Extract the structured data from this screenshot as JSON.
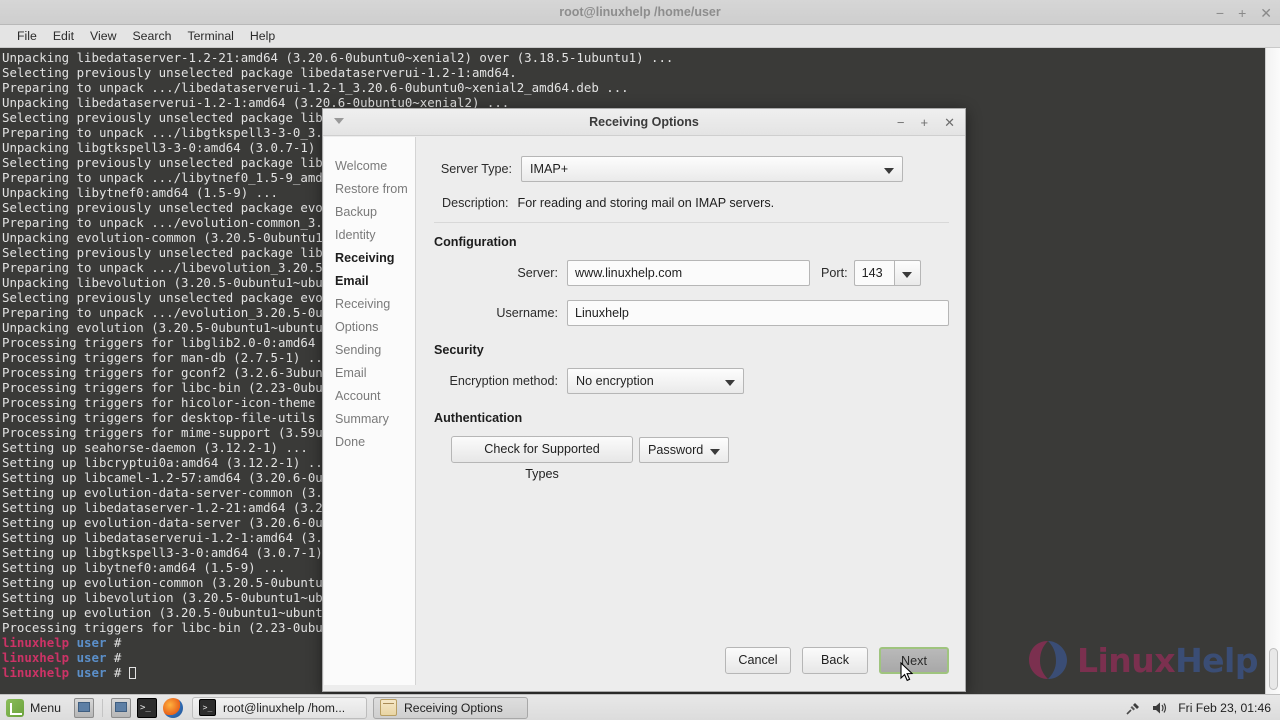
{
  "terminal": {
    "title": "root@linuxhelp /home/user",
    "menus": [
      "File",
      "Edit",
      "View",
      "Search",
      "Terminal",
      "Help"
    ],
    "window_buttons": {
      "minimize": "−",
      "maximize": "+",
      "close": "✕"
    },
    "lines": [
      "Unpacking libedataserver-1.2-21:amd64 (3.20.6-0ubuntu0~xenial2) over (3.18.5-1ubuntu1) ...",
      "Selecting previously unselected package libedataserverui-1.2-1:amd64.",
      "Preparing to unpack .../libedataserverui-1.2-1_3.20.6-0ubuntu0~xenial2_amd64.deb ...",
      "Unpacking libedataserverui-1.2-1:amd64 (3.20.6-0ubuntu0~xenial2) ...",
      "Selecting previously unselected package libgtkspell3-3-0:amd64.",
      "Preparing to unpack .../libgtkspell3-3-0_3.0.7-1_amd64.deb ...",
      "Unpacking libgtkspell3-3-0:amd64 (3.0.7-1) ...",
      "Selecting previously unselected package libytnef0:amd64.",
      "Preparing to unpack .../libytnef0_1.5-9_amd64.deb ...",
      "Unpacking libytnef0:amd64 (1.5-9) ...",
      "Selecting previously unselected package evolution-common.",
      "Preparing to unpack .../evolution-common_3.20.5-0ubuntu1~ubuntu16.04.1_all.deb ...",
      "Unpacking evolution-common (3.20.5-0ubuntu1~ubuntu16.04.1) ...",
      "Selecting previously unselected package libevolution.",
      "Preparing to unpack .../libevolution_3.20.5-0ubuntu1~ubuntu16.04.1_amd64.deb ...",
      "Unpacking libevolution (3.20.5-0ubuntu1~ubuntu16.04.1) ...",
      "Selecting previously unselected package evolution.",
      "Preparing to unpack .../evolution_3.20.5-0ubuntu1~ubuntu16.04.1_amd64.deb ...",
      "Unpacking evolution (3.20.5-0ubuntu1~ubuntu16.04.1) ...",
      "Processing triggers for libglib2.0-0:amd64 (2.48.2-0ubuntu1) ...",
      "Processing triggers for man-db (2.7.5-1) ...",
      "Processing triggers for gconf2 (3.2.6-3ubuntu6) ...",
      "Processing triggers for libc-bin (2.23-0ubuntu7) ...",
      "Processing triggers for hicolor-icon-theme (0.15-0ubuntu1) ...",
      "Processing triggers for desktop-file-utils (0.22-1ubuntu5) ...",
      "Processing triggers for mime-support (3.59ubuntu1) ...",
      "Setting up seahorse-daemon (3.12.2-1) ...",
      "Setting up libcryptui0a:amd64 (3.12.2-1) ...",
      "Setting up libcamel-1.2-57:amd64 (3.20.6-0ubuntu0~xenial2) ...",
      "Setting up evolution-data-server-common (3.20.6-0ubuntu0~xenial2) ...",
      "Setting up libedataserver-1.2-21:amd64 (3.20.6-0ubuntu0~xenial2) ...",
      "Setting up evolution-data-server (3.20.6-0ubuntu0~xenial2) ...",
      "Setting up libedataserverui-1.2-1:amd64 (3.20.6-0ubuntu0~xenial2) ...",
      "Setting up libgtkspell3-3-0:amd64 (3.0.7-1) ...",
      "Setting up libytnef0:amd64 (1.5-9) ...",
      "Setting up evolution-common (3.20.5-0ubuntu1~ubuntu16.04.1) ...",
      "Setting up libevolution (3.20.5-0ubuntu1~ubuntu16.04.1) ...",
      "Setting up evolution (3.20.5-0ubuntu1~ubuntu16.04.1) ...",
      "Processing triggers for libc-bin (2.23-0ubuntu7) ..."
    ],
    "prompt": {
      "host": "linuxhelp",
      "user": "user",
      "symbol": "#"
    },
    "prompt_count": 3
  },
  "watermark": {
    "part1": "Linux",
    "part2": "Help"
  },
  "dialog": {
    "title": "Receiving Options",
    "window_buttons": {
      "minimize": "−",
      "maximize": "+",
      "close": "✕"
    },
    "sidebar": {
      "items": [
        {
          "label": "Welcome",
          "active": false
        },
        {
          "label": "Restore from Backup",
          "active": false
        },
        {
          "label": "Identity",
          "active": false
        },
        {
          "label": "Receiving Email",
          "active": true
        },
        {
          "label": "Receiving Options",
          "active": false
        },
        {
          "label": "Sending Email",
          "active": false
        },
        {
          "label": "Account Summary",
          "active": false
        },
        {
          "label": "Done",
          "active": false
        }
      ]
    },
    "server_type": {
      "label": "Server Type:",
      "value": "IMAP+"
    },
    "description": {
      "label": "Description:",
      "value": "For reading and storing mail on IMAP servers."
    },
    "configuration": {
      "heading": "Configuration",
      "server_label": "Server:",
      "server_value": "www.linuxhelp.com",
      "port_label": "Port:",
      "port_value": "143",
      "username_label": "Username:",
      "username_value": "Linuxhelp"
    },
    "security": {
      "heading": "Security",
      "encryption_label": "Encryption method:",
      "encryption_value": "No encryption"
    },
    "authentication": {
      "heading": "Authentication",
      "check_button": "Check for Supported Types",
      "auth_type_value": "Password"
    },
    "footer": {
      "cancel": "Cancel",
      "back": "Back",
      "next": "Next"
    }
  },
  "taskbar": {
    "menu_label": "Menu",
    "launchers": [
      "show-desktop-icon",
      "terminal-icon",
      "firefox-icon"
    ],
    "tasks": [
      {
        "label": "root@linuxhelp /hom...",
        "icon": "terminal-icon",
        "active": false
      },
      {
        "label": "Receiving Options",
        "icon": "mail-icon",
        "active": true
      }
    ],
    "tray": {
      "clock": "Fri Feb 23, 01:46"
    }
  }
}
